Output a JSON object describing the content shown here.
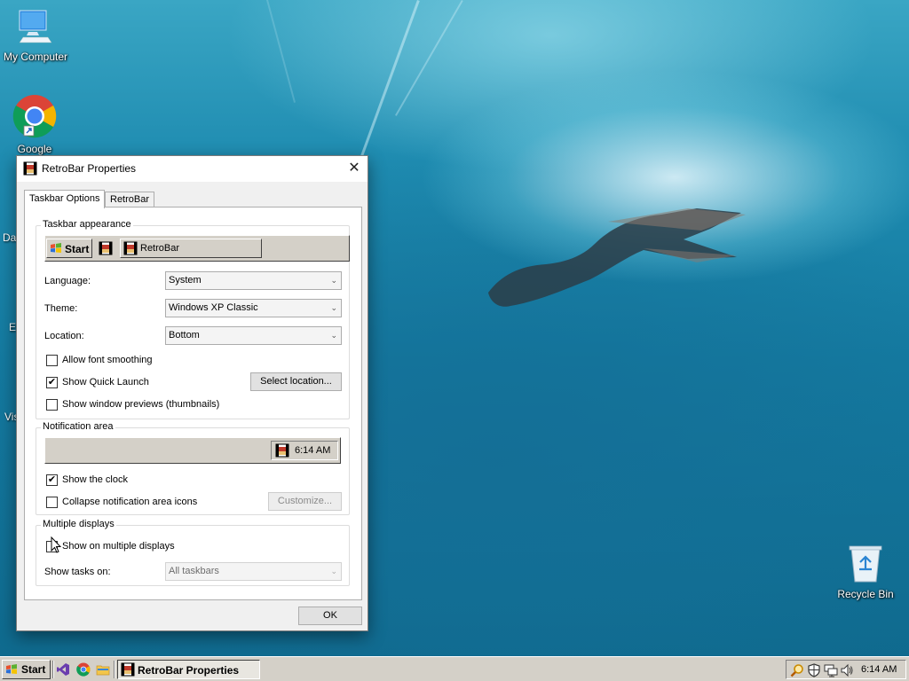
{
  "desktop": {
    "icons": [
      {
        "label": "My Computer",
        "icon": "monitor-icon"
      },
      {
        "label": "Google",
        "icon": "chrome-icon"
      },
      {
        "label": "Recycle Bin",
        "icon": "recycle-bin-icon"
      }
    ],
    "partial_labels": [
      "Da",
      "E",
      "Vis"
    ]
  },
  "dialog": {
    "title": "RetroBar Properties",
    "close_glyph": "✕",
    "tabs": [
      {
        "label": "Taskbar Options",
        "active": true
      },
      {
        "label": "RetroBar",
        "active": false
      }
    ],
    "appearance": {
      "group_title": "Taskbar appearance",
      "preview_start": "Start",
      "preview_task": "RetroBar",
      "language_label": "Language:",
      "language_value": "System",
      "theme_label": "Theme:",
      "theme_value": "Windows XP Classic",
      "location_label": "Location:",
      "location_value": "Bottom",
      "font_smoothing": {
        "label": "Allow font smoothing",
        "checked": false
      },
      "quick_launch": {
        "label": "Show Quick Launch",
        "checked": true
      },
      "select_location_button": "Select location...",
      "thumbnails": {
        "label": "Show window previews (thumbnails)",
        "checked": false
      }
    },
    "notification": {
      "group_title": "Notification area",
      "clock_preview": "6:14 AM",
      "show_clock": {
        "label": "Show the clock",
        "checked": true
      },
      "collapse_icons": {
        "label": "Collapse notification area icons",
        "checked": false
      },
      "customize_button": "Customize..."
    },
    "multiple": {
      "group_title": "Multiple displays",
      "show_multiple": {
        "label": "Show on multiple displays",
        "checked": false
      },
      "show_tasks_label": "Show tasks on:",
      "show_tasks_value": "All taskbars"
    },
    "ok_button": "OK",
    "check_glyph": "✔",
    "combo_arrow": "⌄"
  },
  "taskbar": {
    "start_label": "Start",
    "quick_launch": [
      "visual-studio-icon",
      "chrome-icon",
      "file-explorer-icon"
    ],
    "active_task": "RetroBar Properties",
    "tray_icons": [
      "search-icon",
      "shield-icon",
      "network-icon",
      "volume-icon"
    ],
    "clock": "6:14 AM"
  }
}
